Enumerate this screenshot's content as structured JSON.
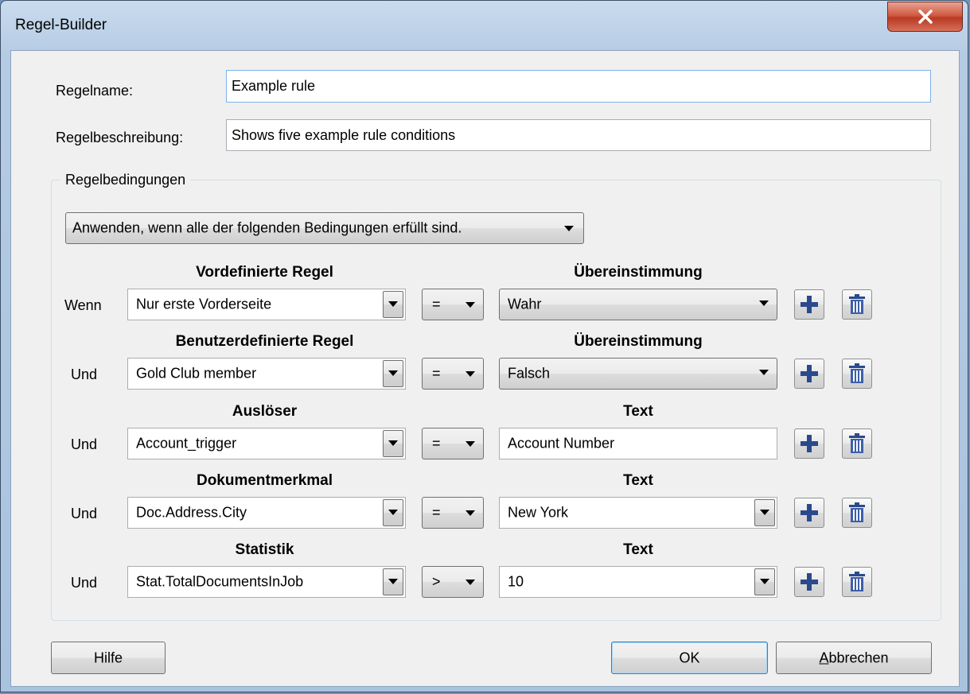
{
  "window": {
    "title": "Regel-Builder",
    "close_label": "x"
  },
  "fields": {
    "rule_name_label": "Regelname:",
    "rule_name_value": "Example rule",
    "rule_description_label": "Regelbeschreibung:",
    "rule_description_value": "Shows five example rule conditions"
  },
  "conditions": {
    "group_title": "Regelbedingungen",
    "apply_mode": "Anwenden, wenn alle der folgenden Bedingungen erfüllt sind.",
    "rows": [
      {
        "connector": "Wenn",
        "left_header": "Vordefinierte Regel",
        "left_value": "Nur erste Vorderseite",
        "operator": "=",
        "right_header": "Übereinstimmung",
        "right_value": "Wahr",
        "right_kind": "dropdown"
      },
      {
        "connector": "Und",
        "left_header": "Benutzerdefinierte Regel",
        "left_value": "Gold Club member",
        "operator": "=",
        "right_header": "Übereinstimmung",
        "right_value": "Falsch",
        "right_kind": "dropdown"
      },
      {
        "connector": "Und",
        "left_header": "Auslöser",
        "left_value": "Account_trigger",
        "operator": "=",
        "right_header": "Text",
        "right_value": "Account Number",
        "right_kind": "text"
      },
      {
        "connector": "Und",
        "left_header": "Dokumentmerkmal",
        "left_value": "Doc.Address.City",
        "operator": "=",
        "right_header": "Text",
        "right_value": "New York",
        "right_kind": "combo"
      },
      {
        "connector": "Und",
        "left_header": "Statistik",
        "left_value": "Stat.TotalDocumentsInJob",
        "operator": ">",
        "right_header": "Text",
        "right_value": "10",
        "right_kind": "combo"
      }
    ]
  },
  "icons": {
    "add": "plus-icon",
    "delete": "trash-icon"
  },
  "buttons": {
    "help": "Hilfe",
    "ok": "OK",
    "cancel_mnemonic": "A",
    "cancel_rest": "bbrechen"
  },
  "colors": {
    "accent_icon": "#2b4a8c",
    "close_red": "#c9452e",
    "focus_border": "#7eb4ea"
  }
}
